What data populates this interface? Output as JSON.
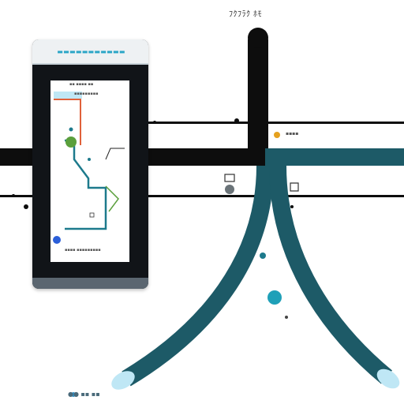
{
  "header": {
    "caption": "ﾌｸﾌﾗｸ ﾎﾓ"
  },
  "phone": {
    "app_title": "▬▬▬▬▬▬▬▬▬▬▬",
    "screen_heading": "▪▪ ▪▪▪▪ ▪▪",
    "screen_footer": "▪▪▪▪ ▪▪▪▪▪▪▪▪▪",
    "legend_text": "▪▪▪▪▪▪▪▪▪"
  },
  "labels": {
    "junction_label": "▪▪▪▪",
    "footer_caption": "●● ▪▪ ▪▪"
  },
  "colors": {
    "road": "#0d0d0d",
    "teal_route": "#1d5a67",
    "accent_blue": "#2e91c8",
    "accent_green": "#5a9f3c",
    "accent_orange": "#e0613a",
    "accent_yellow": "#e5a11f",
    "glow": "#bfe7f5"
  },
  "icons": [
    "location-pin-icon",
    "camera-icon",
    "link-icon",
    "start-dot-icon"
  ]
}
